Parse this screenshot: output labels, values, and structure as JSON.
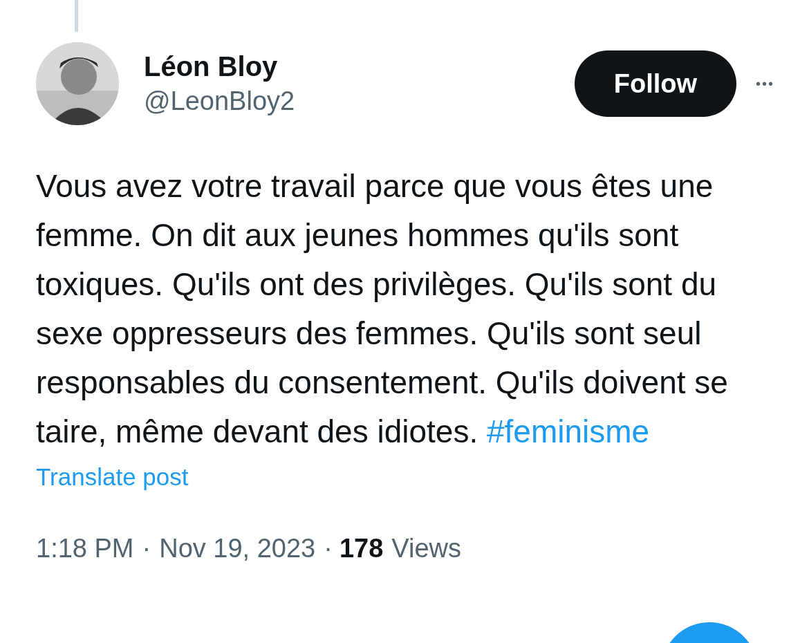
{
  "author": {
    "name": "Léon Bloy",
    "handle": "@LeonBloy2"
  },
  "follow_button": "Follow",
  "more_menu": "•••",
  "post": {
    "text": "Vous avez votre travail parce que vous êtes une femme. On dit aux jeunes hommes qu'ils sont toxiques. Qu'ils ont des privilèges. Qu'ils sont du sexe oppresseurs des femmes. Qu'ils sont seul responsables du consentement. Qu'ils doivent se taire, même devant des idiotes.",
    "hashtag": "#feminisme"
  },
  "translate_link": "Translate post",
  "meta": {
    "time": "1:18 PM",
    "separator": "·",
    "date": "Nov 19, 2023",
    "views_count": "178",
    "views_label": "Views"
  }
}
